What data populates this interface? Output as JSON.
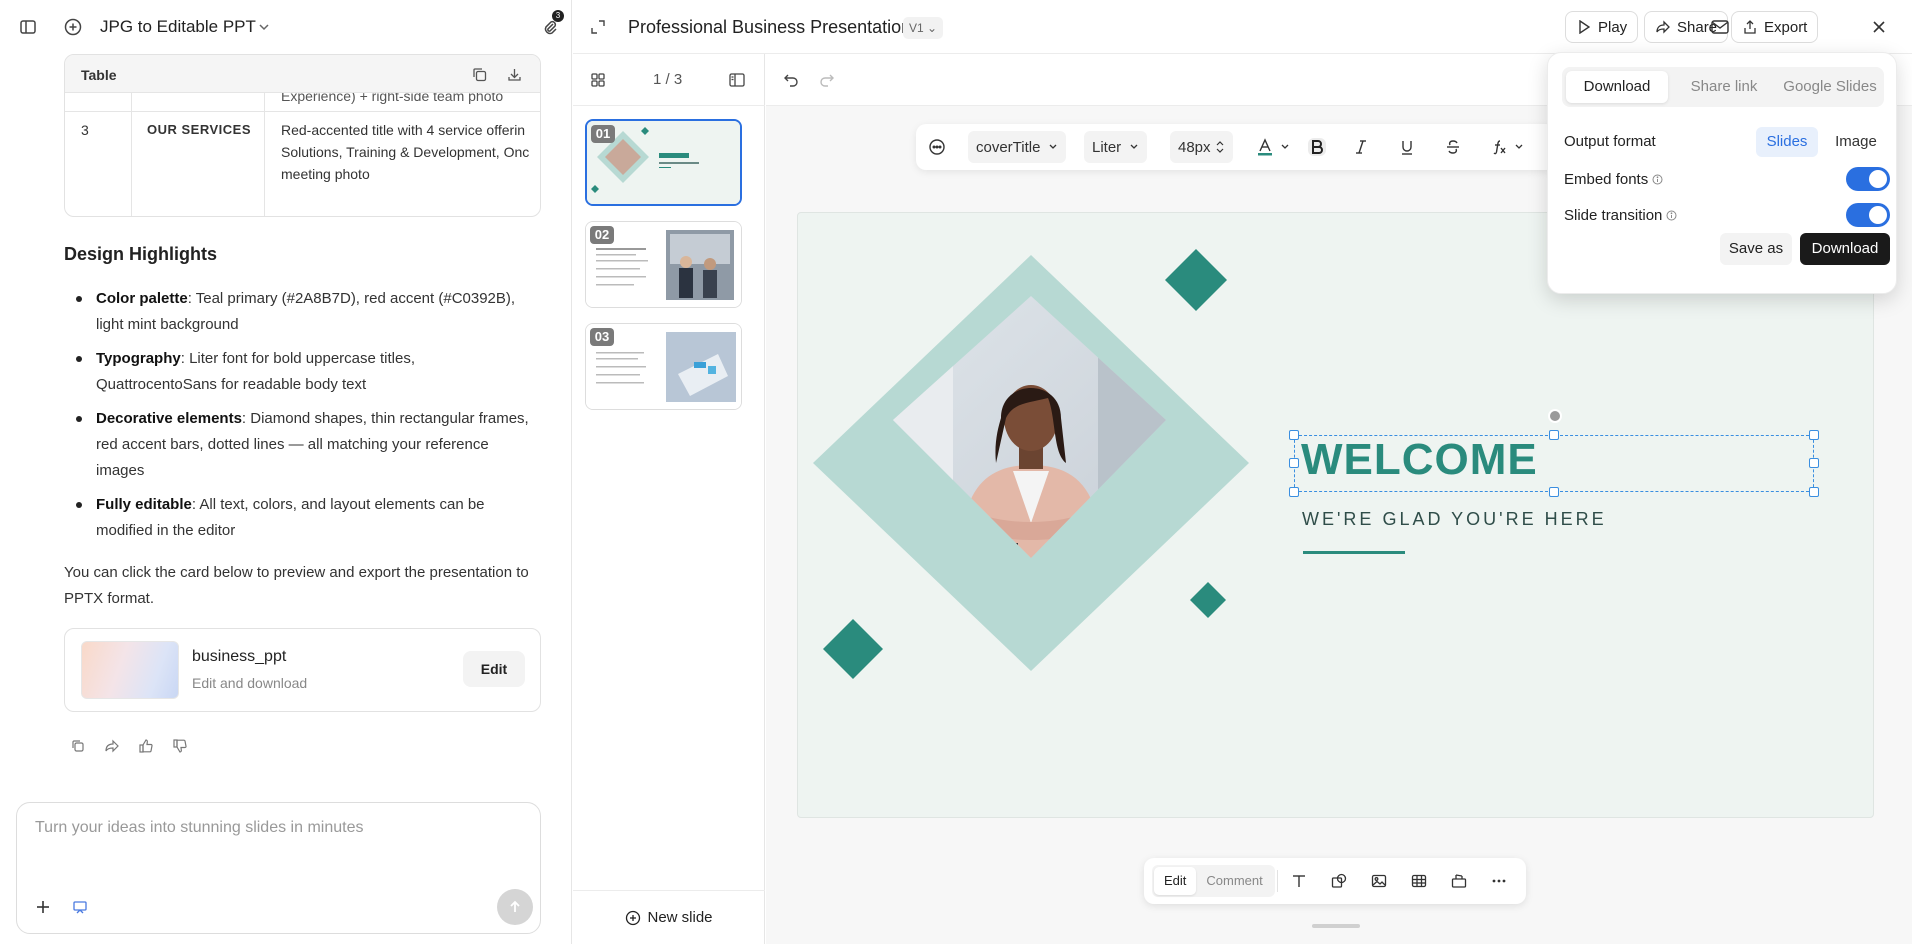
{
  "chat": {
    "title": "JPG to Editable PPT",
    "attachment_count": "3",
    "table": {
      "label": "Table",
      "rows": [
        {
          "num": "",
          "name": "",
          "desc": "Experience) + right-side team photo"
        },
        {
          "num": "3",
          "name": "OUR SERVICES",
          "desc_lines": [
            "Red-accented title with 4 service offerin",
            "Solutions, Training & Development, Onc",
            "meeting photo"
          ]
        }
      ]
    },
    "design_title": "Design Highlights",
    "bullets": [
      {
        "label": "Color palette",
        "text": ": Teal primary (#2A8B7D), red accent (#C0392B), light mint background"
      },
      {
        "label": "Typography",
        "text": ": Liter font for bold uppercase titles, QuattrocentoSans for readable body text"
      },
      {
        "label": "Decorative elements",
        "text": ": Diamond shapes, thin rectangular frames, red accent bars, dotted lines — all matching your reference images"
      },
      {
        "label": "Fully editable",
        "text": ": All text, colors, and layout elements can be modified in the editor"
      }
    ],
    "outro": "You can click the card below to preview and export the presentation to PPTX format.",
    "file_card": {
      "name": "business_ppt",
      "subtitle": "Edit and download",
      "edit_label": "Edit"
    },
    "composer_placeholder": "Turn your ideas into stunning slides in minutes"
  },
  "topbar": {
    "title": "Professional Business Presentation",
    "version": "V1",
    "play_label": "Play",
    "share_label": "Share",
    "export_label": "Export"
  },
  "thumbs": {
    "page_count": "1 / 3",
    "slides": [
      {
        "num": "01"
      },
      {
        "num": "02"
      },
      {
        "num": "03"
      }
    ],
    "new_slide_label": "New slide"
  },
  "format_bar": {
    "style": "coverTitle",
    "font": "Liter",
    "size": "48px"
  },
  "slide": {
    "title": "WELCOME",
    "subtitle": "WE'RE GLAD YOU'RE HERE",
    "colors": {
      "teal": "#2A8B7D",
      "mint_frame": "#B7D9D3",
      "background": "#EEF4F1"
    }
  },
  "bottom_bar": {
    "edit_label": "Edit",
    "comment_label": "Comment"
  },
  "download_popover": {
    "tabs": [
      "Download",
      "Share link",
      "Google Slides"
    ],
    "output_format_label": "Output format",
    "format_options": [
      "Slides",
      "Image"
    ],
    "embed_fonts_label": "Embed fonts",
    "embed_fonts_on": true,
    "transition_label": "Slide transition",
    "transition_on": true,
    "save_as_label": "Save as",
    "download_label": "Download"
  }
}
